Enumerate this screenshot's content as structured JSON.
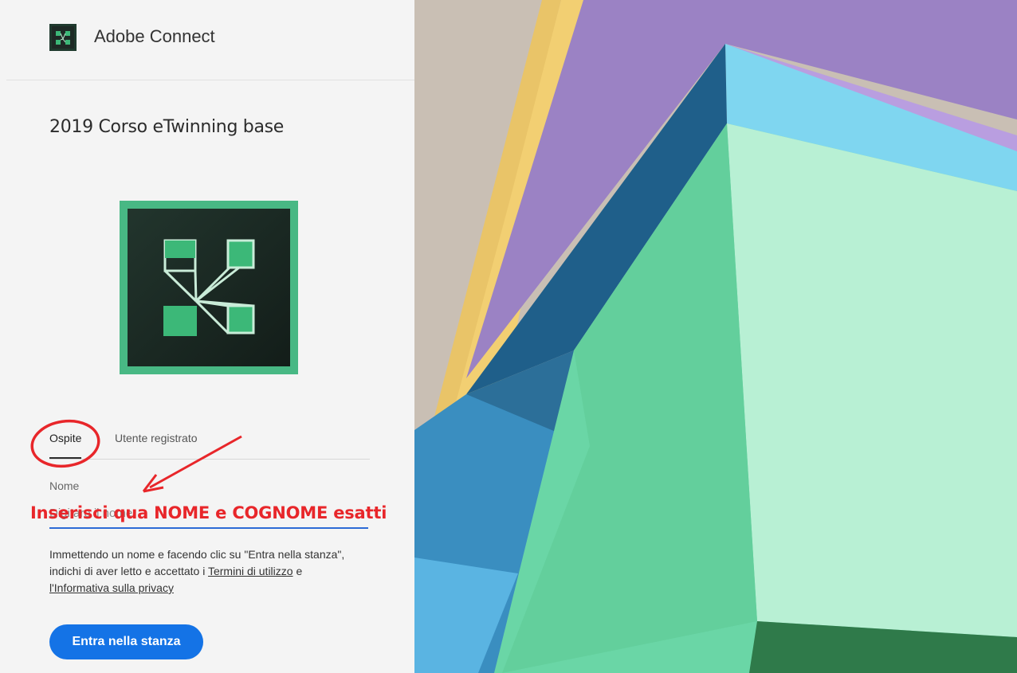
{
  "header": {
    "app_title": "Adobe Connect",
    "logo_icon": "adobe-connect-icon"
  },
  "room": {
    "title": "2019 Corso eTwinning base"
  },
  "tabs": [
    {
      "label": "Ospite",
      "selected": true
    },
    {
      "label": "Utente registrato",
      "selected": false
    }
  ],
  "form": {
    "name_label": "Nome",
    "name_placeholder": "Digitare il nome",
    "terms_prefix": "Immettendo un nome e facendo clic su \"Entra nella stanza\", indichi di aver letto e accettato i ",
    "terms_link": "Termini di utilizzo",
    "terms_middle": " e ",
    "privacy_link": "l'Informativa sulla privacy",
    "submit_label": "Entra nella stanza"
  },
  "annotation": {
    "text": "Inserisci qua NOME e COGNOME esatti",
    "color": "#e8262a"
  },
  "colors": {
    "accent": "#1473e6",
    "logo_green": "#3cb878",
    "logo_dark": "#1a2b24"
  }
}
